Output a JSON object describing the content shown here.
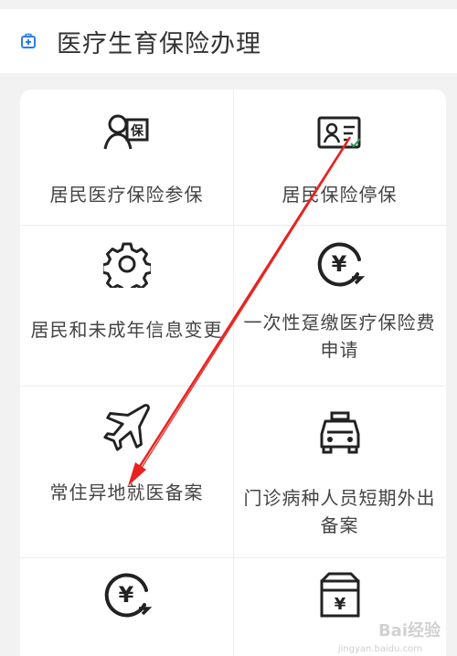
{
  "header": {
    "title": "医疗生育保险办理",
    "icon": "medical-kit-icon",
    "accent_color": "#2b7de9"
  },
  "tiles": [
    {
      "label": "居民医疗保险参保",
      "icon": "person-insurance-icon"
    },
    {
      "label": "居民保险停保",
      "icon": "id-card-check-icon"
    },
    {
      "label": "居民和未成年信息变更",
      "icon": "gear-icon"
    },
    {
      "label": "一次性趸缴医疗保险费\n申请",
      "icon": "yuan-coin-icon"
    },
    {
      "label": "常住异地就医备案",
      "icon": "airplane-icon"
    },
    {
      "label": "门诊病种人员短期外出\n备案",
      "icon": "taxi-icon"
    },
    {
      "label": "",
      "icon": "yuan-coin-icon"
    },
    {
      "label": "",
      "icon": "yuan-wallet-icon"
    }
  ],
  "annotation": {
    "color": "#e8231f"
  },
  "watermark": {
    "text": "Bai经验",
    "sub": "jingyan.baidu.com"
  }
}
